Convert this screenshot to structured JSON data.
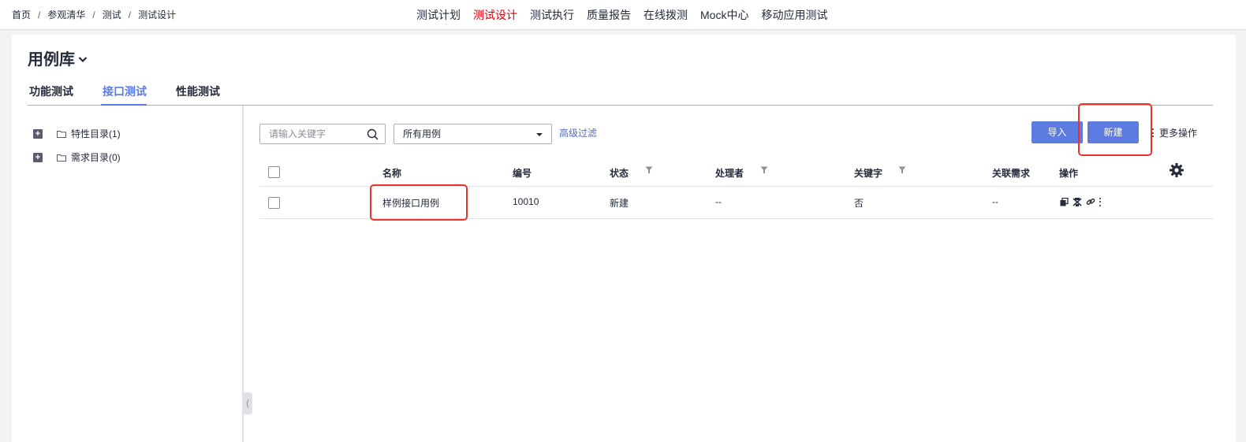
{
  "breadcrumb": [
    "首页",
    "参观清华",
    "测试",
    "测试设计"
  ],
  "breadcrumb_sep": "/",
  "topnav": [
    {
      "label": "测试计划",
      "active": false
    },
    {
      "label": "测试设计",
      "active": true
    },
    {
      "label": "测试执行",
      "active": false
    },
    {
      "label": "质量报告",
      "active": false
    },
    {
      "label": "在线拨测",
      "active": false
    },
    {
      "label": "Mock中心",
      "active": false
    },
    {
      "label": "移动应用测试",
      "active": false
    }
  ],
  "library": {
    "title": "用例库"
  },
  "tabs": [
    {
      "label": "功能测试",
      "active": false
    },
    {
      "label": "接口测试",
      "active": true
    },
    {
      "label": "性能测试",
      "active": false
    }
  ],
  "tree": [
    {
      "label": "特性目录(1)"
    },
    {
      "label": "需求目录(0)"
    }
  ],
  "toolbar": {
    "search_placeholder": "请输入关键字",
    "filter_value": "所有用例",
    "advanced_filter": "高级过滤",
    "import": "导入",
    "new": "新建",
    "more": "更多操作"
  },
  "table": {
    "columns": [
      "名称",
      "编号",
      "状态",
      "处理者",
      "关键字",
      "关联需求",
      "操作"
    ],
    "rows": [
      {
        "name": "样例接口用例",
        "id": "10010",
        "status": "新建",
        "handler": "--",
        "keyword": "否",
        "requirement": "--"
      }
    ]
  },
  "colors": {
    "accent": "#5e7ce0",
    "active_nav": "#d7000f",
    "highlight": "#e8332b"
  }
}
